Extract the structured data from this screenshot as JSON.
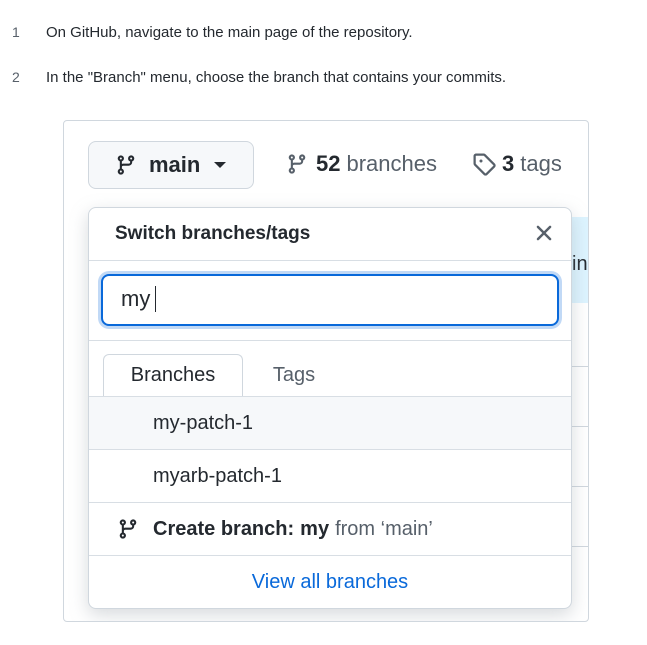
{
  "steps": [
    {
      "num": "1",
      "text": "On GitHub, navigate to the main page of the repository."
    },
    {
      "num": "2",
      "text": "In the \"Branch\" menu, choose the branch that contains your commits."
    }
  ],
  "repo_header": {
    "branch_button_label": "main",
    "branches_count": "52",
    "branches_label": "branches",
    "tags_count": "3",
    "tags_label": "tags"
  },
  "background": {
    "partial_text": "in"
  },
  "dropdown": {
    "title": "Switch branches/tags",
    "filter_value": "my",
    "tabs": [
      {
        "label": "Branches",
        "selected": true
      },
      {
        "label": "Tags",
        "selected": false
      }
    ],
    "branch_results": [
      "my-patch-1",
      "myarb-patch-1"
    ],
    "create_branch": {
      "prefix": "Create branch:",
      "name": "my",
      "from_text": "from ‘main’"
    },
    "view_all_label": "View all branches"
  },
  "icons": {
    "branch": "git-branch-icon",
    "tag": "tag-icon",
    "close": "x-icon",
    "caret": "triangle-down-icon"
  },
  "colors": {
    "accent_blue": "#0969da",
    "text": "#24292f",
    "muted": "#57606a",
    "border": "#d0d7de"
  }
}
